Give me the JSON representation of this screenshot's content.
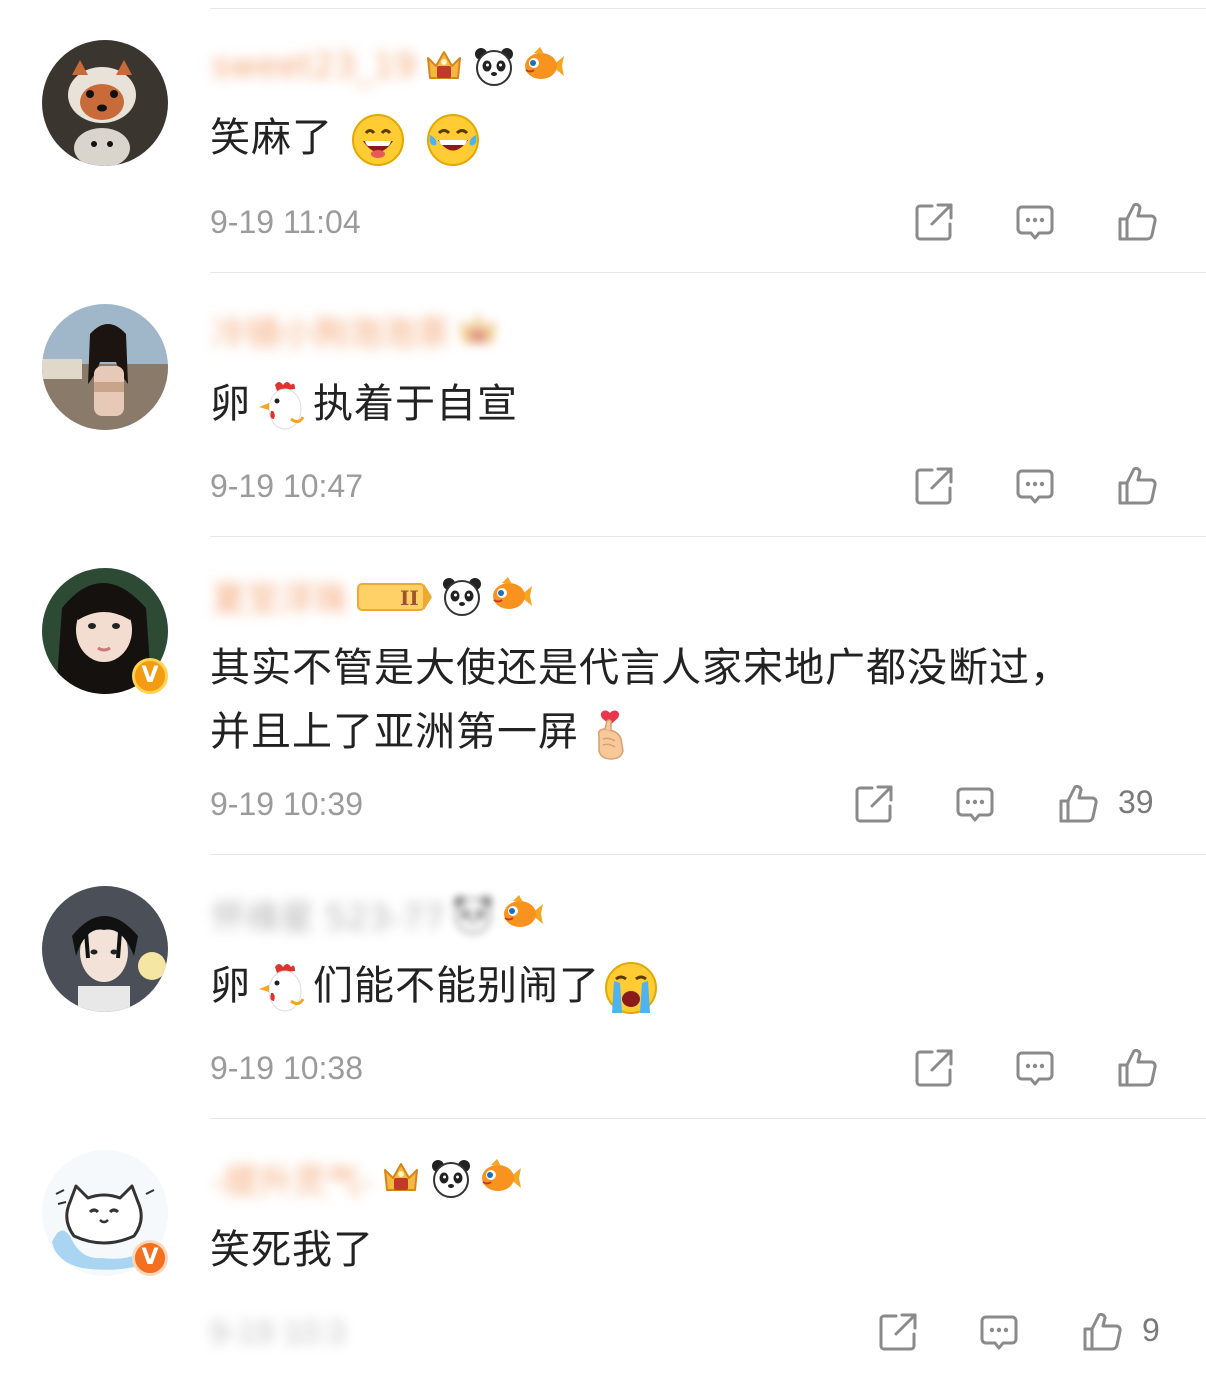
{
  "comments": [
    {
      "username": "sweet23_19",
      "content_parts": [
        "笑麻了"
      ],
      "emojis": [
        "grinning-face-emoji",
        "laughing-tears-emoji"
      ],
      "time": "9-19 11:04",
      "likes": "",
      "badges": [
        "crown-level-7-badge",
        "panda-badge",
        "goldfish-badge"
      ]
    },
    {
      "username": "冷镜小狗泡泡茶",
      "content_parts": [
        "卵",
        "执着于自宣"
      ],
      "emojis": [
        "rooster-emoji"
      ],
      "time": "9-19 10:47",
      "likes": "",
      "badges": [
        "crown-badge"
      ]
    },
    {
      "username": "夏至浮珠",
      "content_line1": "其实不管是大使还是代言人家宋地广都没断过，",
      "content_line2": "并且上了亚洲第一屏",
      "emojis": [
        "finger-heart-emoji"
      ],
      "time": "9-19 10:39",
      "likes": "39",
      "badges": [
        "level-badge",
        "panda-badge",
        "goldfish-badge"
      ]
    },
    {
      "username": "怀缘星 523-77",
      "content_parts": [
        "卵",
        "们能不能别闹了"
      ],
      "emojis": [
        "rooster-emoji",
        "crying-face-emoji"
      ],
      "time": "9-19 10:38",
      "likes": "",
      "badges": [
        "panda-badge",
        "goldfish-badge"
      ]
    },
    {
      "username": "-提升灵气-",
      "content_parts": [
        "笑死我了"
      ],
      "emojis": [],
      "time": "9-19 10:3",
      "likes": "9",
      "badges": [
        "crown-level-6-badge",
        "panda-badge",
        "goldfish-badge"
      ]
    }
  ],
  "verified_badge": "V",
  "icons": {
    "share": "share-icon",
    "comment": "comment-icon",
    "like": "thumbs-up-icon"
  },
  "colors": {
    "username": "#f08a4b",
    "time": "#9b9b9b",
    "icon": "#8a8a8a",
    "verified": "#f39c12"
  }
}
